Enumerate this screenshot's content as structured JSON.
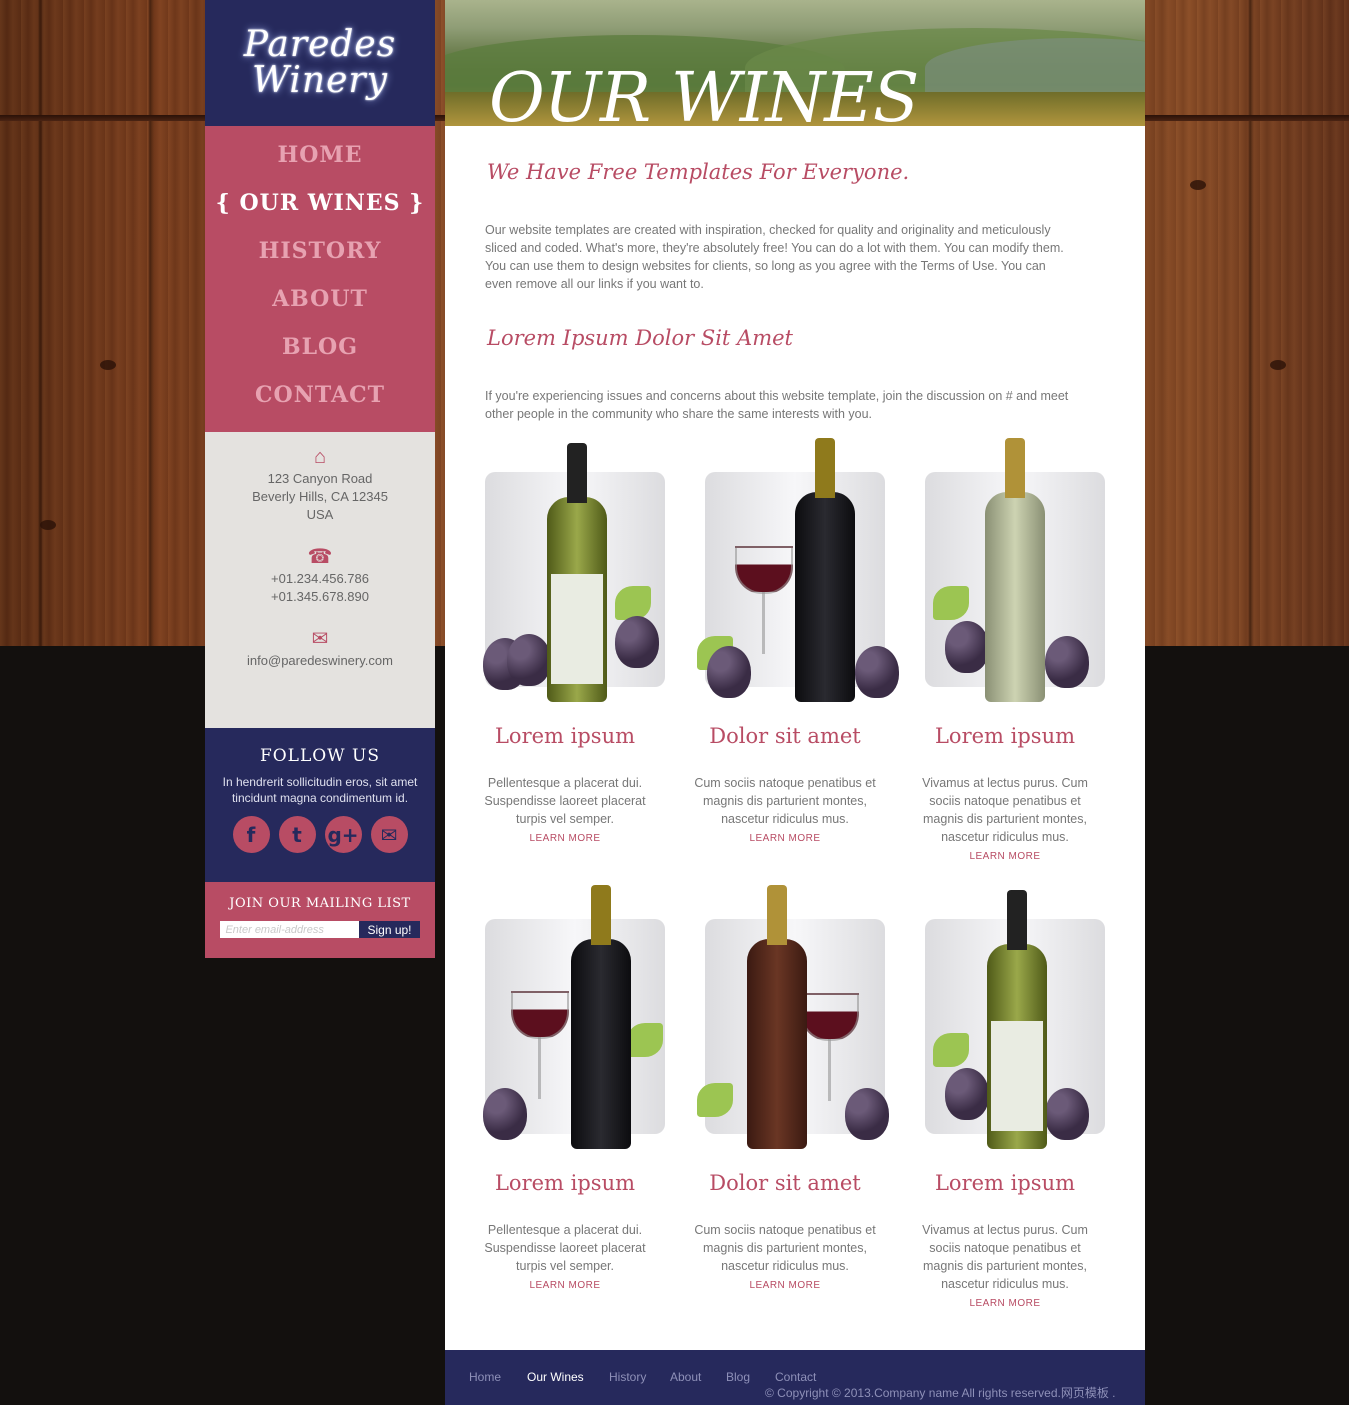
{
  "brand": {
    "logo_line1": "Paredes",
    "logo_line2": "Winery"
  },
  "nav": {
    "items": [
      {
        "label": "HOME"
      },
      {
        "label": "{ OUR WINES }"
      },
      {
        "label": "HISTORY"
      },
      {
        "label": "ABOUT"
      },
      {
        "label": "BLOG"
      },
      {
        "label": "CONTACT"
      }
    ]
  },
  "contact": {
    "address_line1": "123 Canyon Road",
    "address_line2": "Beverly Hills, CA 12345",
    "address_line3": "USA",
    "phone1": "+01.234.456.786",
    "phone2": "+01.345.678.890",
    "email": "info@paredeswinery.com",
    "icons": [
      "home-icon",
      "phone-icon",
      "mail-icon"
    ]
  },
  "follow": {
    "title": "FOLLOW US",
    "text": "In hendrerit sollicitudin eros, sit amet tincidunt magna condimentum id.",
    "social_icons": [
      "facebook-icon",
      "twitter-icon",
      "google-plus-icon",
      "email-icon"
    ]
  },
  "mailing": {
    "title": "JOIN OUR MAILING LIST",
    "placeholder": "Enter email-address",
    "button": "Sign up!"
  },
  "banner": {
    "title": "OUR WINES"
  },
  "intro": {
    "heading": "We Have Free Templates For Everyone.",
    "text": "Our website templates are created with inspiration, checked for quality and originality and meticulously sliced and coded. What's more, they're absolutely free! You can do a lot with them. You can modify them. You can use them to design websites for clients, so long as you agree with the Terms of Use. You can even remove all our links if you want to."
  },
  "section2": {
    "heading": "Lorem Ipsum Dolor Sit Amet",
    "text": "If you're experiencing issues and concerns about this website template, join the discussion on # and meet other people in the community who share the same interests with you."
  },
  "products": [
    {
      "title": "Lorem ipsum",
      "desc": "Pellentesque a placerat dui. Suspendisse laoreet placerat turpis vel semper.",
      "more": "LEARN MORE"
    },
    {
      "title": "Dolor sit amet",
      "desc": "Cum sociis natoque penatibus et magnis dis parturient montes, nascetur ridiculus mus.",
      "more": "LEARN MORE"
    },
    {
      "title": "Lorem ipsum",
      "desc": "Vivamus at lectus purus. Cum sociis natoque penatibus et magnis dis parturient montes, nascetur ridiculus mus.",
      "more": "LEARN MORE"
    },
    {
      "title": "Lorem ipsum",
      "desc": "Pellentesque a placerat dui. Suspendisse laoreet placerat turpis vel semper.",
      "more": "LEARN MORE"
    },
    {
      "title": "Dolor sit amet",
      "desc": "Cum sociis natoque penatibus et magnis dis parturient montes, nascetur ridiculus mus.",
      "more": "LEARN MORE"
    },
    {
      "title": "Lorem ipsum",
      "desc": "Vivamus at lectus purus. Cum sociis natoque penatibus et magnis dis parturient montes, nascetur ridiculus mus.",
      "more": "LEARN MORE"
    }
  ],
  "footer": {
    "links": [
      "Home",
      "Our Wines",
      "History",
      "About",
      "Blog",
      "Contact"
    ],
    "copyright": "© Copyright © 2013.Company name All rights reserved.网页模板 ."
  },
  "colors": {
    "navy": "#26295c",
    "rose": "#b84c64",
    "contact_bg": "#e4e2df",
    "dark_bg": "#13100e"
  }
}
